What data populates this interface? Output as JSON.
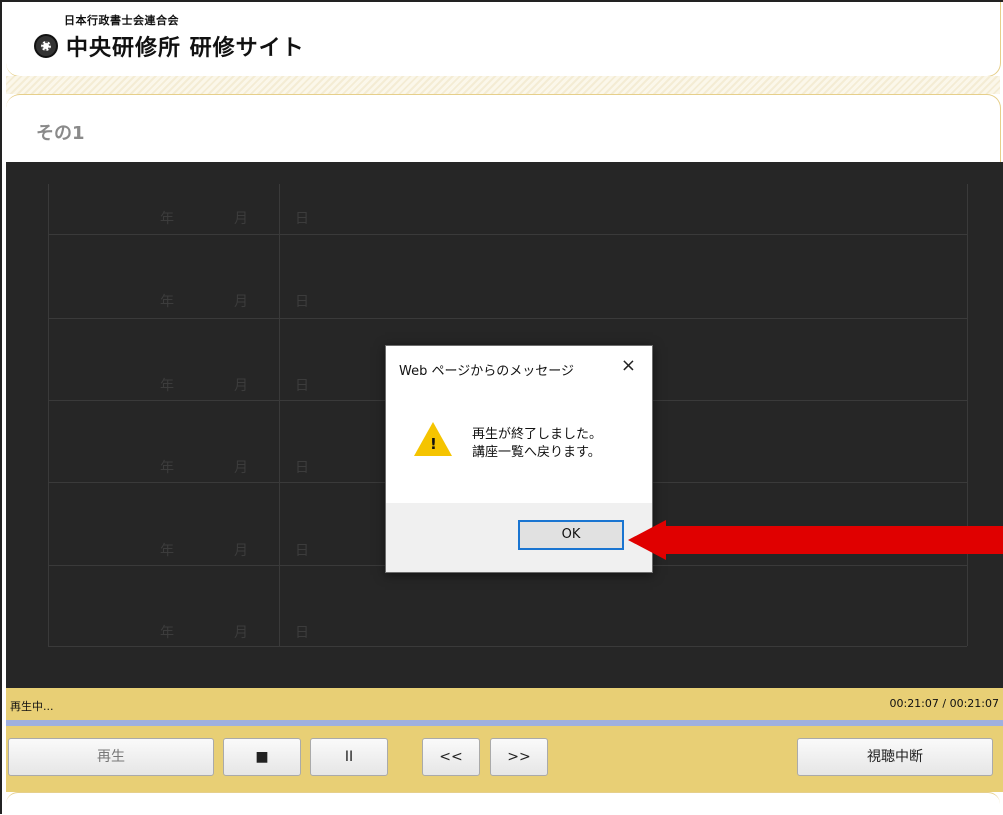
{
  "header": {
    "org_name": "日本行政書士会連合会",
    "site_title": "中央研修所 研修サイト",
    "logo_icon": "seal-emblem-icon"
  },
  "section": {
    "title": "その1"
  },
  "video_rows": [
    {
      "y": "年",
      "m": "月",
      "d": "日"
    },
    {
      "y": "年",
      "m": "月",
      "d": "日"
    },
    {
      "y": "年",
      "m": "月",
      "d": "日"
    },
    {
      "y": "年",
      "m": "月",
      "d": "日"
    },
    {
      "y": "年",
      "m": "月",
      "d": "日"
    },
    {
      "y": "年",
      "m": "月",
      "d": "日"
    }
  ],
  "dialog": {
    "title": "Web ページからのメッセージ",
    "close_label": "×",
    "icon": "warning-icon",
    "message_line1": "再生が終了しました。",
    "message_line2": "講座一覧へ戻ります。",
    "ok_label": "OK"
  },
  "status": {
    "state": "再生中...",
    "time": "00:21:07 / 00:21:07",
    "progress": 1.0
  },
  "controls": {
    "play_label": "再生",
    "stop_label": "■",
    "pause_label": "II",
    "rewind_label": "<<",
    "forward_label": ">>",
    "stop_viewing_label": "視聴中断"
  },
  "colors": {
    "accent_gold": "#e8cf75",
    "video_bg": "#262626",
    "ok_focus": "#1a75d1",
    "arrow_red": "#e00000",
    "progress": "#9fb0df"
  }
}
